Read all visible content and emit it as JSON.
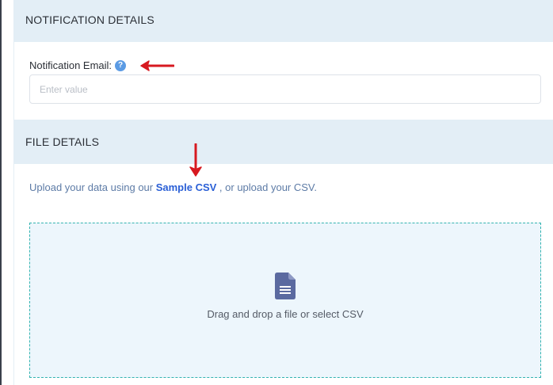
{
  "sections": {
    "notification_title": "NOTIFICATION DETAILS",
    "file_title": "FILE DETAILS"
  },
  "notification": {
    "label": "Notification Email:",
    "help_icon": "question-circle-icon",
    "placeholder": "Enter value",
    "value": ""
  },
  "upload": {
    "prefix": "Upload your data using our ",
    "link_label": "Sample CSV",
    "suffix": " , or upload your CSV."
  },
  "dropzone": {
    "icon": "document-icon",
    "text": "Drag and drop a file or select CSV"
  },
  "colors": {
    "header_bg": "#e3eef6",
    "link": "#2a5fd6",
    "dropzone_border": "#33b3b0",
    "dropzone_bg": "#edf6fc",
    "annotation_arrow": "#d71920",
    "help_icon": "#5b9be4",
    "file_icon": "#5b6aa0"
  }
}
